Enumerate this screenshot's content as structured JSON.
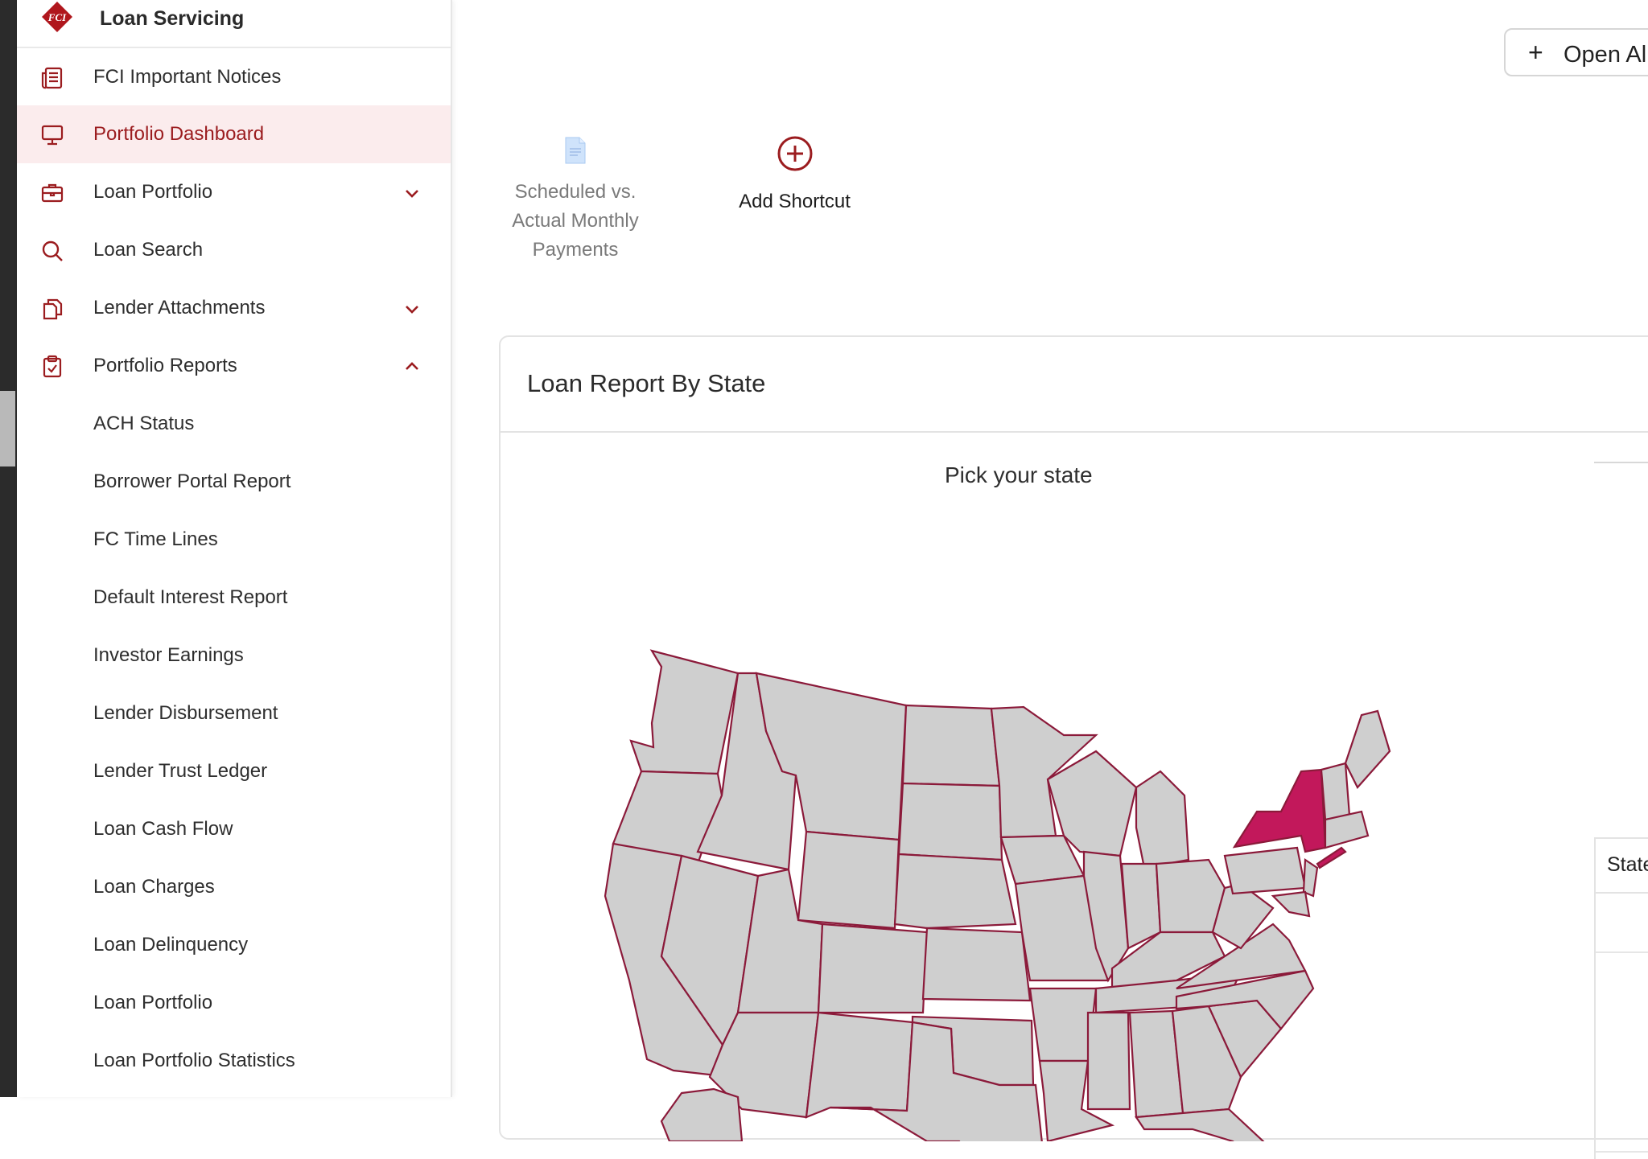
{
  "app": {
    "title": "Loan Servicing",
    "brand_color": "#9b1c1f"
  },
  "sidebar": {
    "items": [
      {
        "label": "FCI Important Notices",
        "icon": "newspaper-icon"
      },
      {
        "label": "Portfolio Dashboard",
        "icon": "monitor-icon",
        "active": true
      },
      {
        "label": "Loan Portfolio",
        "icon": "briefcase-icon",
        "expandable": true
      },
      {
        "label": "Loan Search",
        "icon": "search-icon"
      },
      {
        "label": "Lender Attachments",
        "icon": "files-icon",
        "expandable": true
      },
      {
        "label": "Portfolio Reports",
        "icon": "clipboard-icon",
        "expanded": true
      }
    ],
    "reports": [
      "ACH Status",
      "Borrower Portal Report",
      "FC Time Lines",
      "Default Interest Report",
      "Investor Earnings",
      "Lender Disbursement",
      "Lender Trust Ledger",
      "Loan Cash Flow",
      "Loan Charges",
      "Loan Delinquency",
      "Loan Portfolio",
      "Loan Portfolio Statistics"
    ]
  },
  "toolbar": {
    "open_button": "Open Al"
  },
  "shortcuts": [
    {
      "label": "Scheduled vs. Actual Monthly Payments",
      "icon": "document-icon"
    },
    {
      "label": "Add Shortcut",
      "icon": "plus-circle-icon"
    }
  ],
  "report": {
    "title": "Loan Report By State",
    "map_prompt": "Pick your state",
    "selected_state": "New York",
    "highlight_color": "#c2185b",
    "table_header": "State"
  }
}
